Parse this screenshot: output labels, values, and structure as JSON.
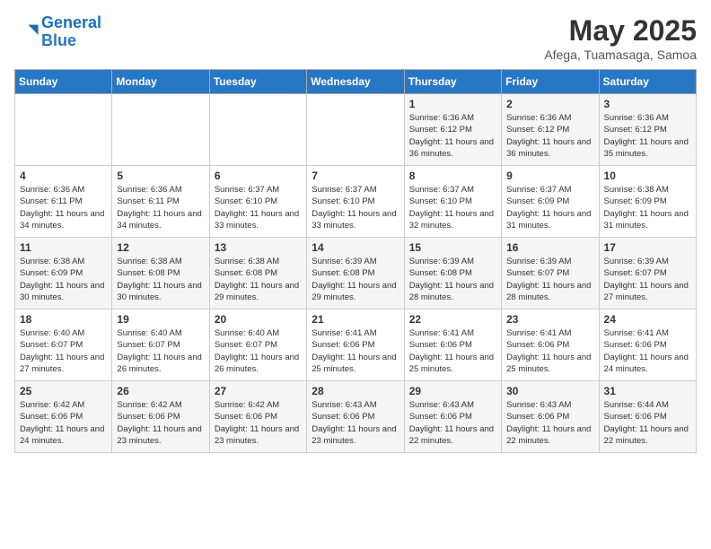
{
  "logo": {
    "line1": "General",
    "line2": "Blue"
  },
  "title": "May 2025",
  "subtitle": "Afega, Tuamasaga, Samoa",
  "weekdays": [
    "Sunday",
    "Monday",
    "Tuesday",
    "Wednesday",
    "Thursday",
    "Friday",
    "Saturday"
  ],
  "weeks": [
    [
      {
        "day": "",
        "info": ""
      },
      {
        "day": "",
        "info": ""
      },
      {
        "day": "",
        "info": ""
      },
      {
        "day": "",
        "info": ""
      },
      {
        "day": "1",
        "info": "Sunrise: 6:36 AM\nSunset: 6:12 PM\nDaylight: 11 hours and 36 minutes."
      },
      {
        "day": "2",
        "info": "Sunrise: 6:36 AM\nSunset: 6:12 PM\nDaylight: 11 hours and 36 minutes."
      },
      {
        "day": "3",
        "info": "Sunrise: 6:36 AM\nSunset: 6:12 PM\nDaylight: 11 hours and 35 minutes."
      }
    ],
    [
      {
        "day": "4",
        "info": "Sunrise: 6:36 AM\nSunset: 6:11 PM\nDaylight: 11 hours and 34 minutes."
      },
      {
        "day": "5",
        "info": "Sunrise: 6:36 AM\nSunset: 6:11 PM\nDaylight: 11 hours and 34 minutes."
      },
      {
        "day": "6",
        "info": "Sunrise: 6:37 AM\nSunset: 6:10 PM\nDaylight: 11 hours and 33 minutes."
      },
      {
        "day": "7",
        "info": "Sunrise: 6:37 AM\nSunset: 6:10 PM\nDaylight: 11 hours and 33 minutes."
      },
      {
        "day": "8",
        "info": "Sunrise: 6:37 AM\nSunset: 6:10 PM\nDaylight: 11 hours and 32 minutes."
      },
      {
        "day": "9",
        "info": "Sunrise: 6:37 AM\nSunset: 6:09 PM\nDaylight: 11 hours and 31 minutes."
      },
      {
        "day": "10",
        "info": "Sunrise: 6:38 AM\nSunset: 6:09 PM\nDaylight: 11 hours and 31 minutes."
      }
    ],
    [
      {
        "day": "11",
        "info": "Sunrise: 6:38 AM\nSunset: 6:09 PM\nDaylight: 11 hours and 30 minutes."
      },
      {
        "day": "12",
        "info": "Sunrise: 6:38 AM\nSunset: 6:08 PM\nDaylight: 11 hours and 30 minutes."
      },
      {
        "day": "13",
        "info": "Sunrise: 6:38 AM\nSunset: 6:08 PM\nDaylight: 11 hours and 29 minutes."
      },
      {
        "day": "14",
        "info": "Sunrise: 6:39 AM\nSunset: 6:08 PM\nDaylight: 11 hours and 29 minutes."
      },
      {
        "day": "15",
        "info": "Sunrise: 6:39 AM\nSunset: 6:08 PM\nDaylight: 11 hours and 28 minutes."
      },
      {
        "day": "16",
        "info": "Sunrise: 6:39 AM\nSunset: 6:07 PM\nDaylight: 11 hours and 28 minutes."
      },
      {
        "day": "17",
        "info": "Sunrise: 6:39 AM\nSunset: 6:07 PM\nDaylight: 11 hours and 27 minutes."
      }
    ],
    [
      {
        "day": "18",
        "info": "Sunrise: 6:40 AM\nSunset: 6:07 PM\nDaylight: 11 hours and 27 minutes."
      },
      {
        "day": "19",
        "info": "Sunrise: 6:40 AM\nSunset: 6:07 PM\nDaylight: 11 hours and 26 minutes."
      },
      {
        "day": "20",
        "info": "Sunrise: 6:40 AM\nSunset: 6:07 PM\nDaylight: 11 hours and 26 minutes."
      },
      {
        "day": "21",
        "info": "Sunrise: 6:41 AM\nSunset: 6:06 PM\nDaylight: 11 hours and 25 minutes."
      },
      {
        "day": "22",
        "info": "Sunrise: 6:41 AM\nSunset: 6:06 PM\nDaylight: 11 hours and 25 minutes."
      },
      {
        "day": "23",
        "info": "Sunrise: 6:41 AM\nSunset: 6:06 PM\nDaylight: 11 hours and 25 minutes."
      },
      {
        "day": "24",
        "info": "Sunrise: 6:41 AM\nSunset: 6:06 PM\nDaylight: 11 hours and 24 minutes."
      }
    ],
    [
      {
        "day": "25",
        "info": "Sunrise: 6:42 AM\nSunset: 6:06 PM\nDaylight: 11 hours and 24 minutes."
      },
      {
        "day": "26",
        "info": "Sunrise: 6:42 AM\nSunset: 6:06 PM\nDaylight: 11 hours and 23 minutes."
      },
      {
        "day": "27",
        "info": "Sunrise: 6:42 AM\nSunset: 6:06 PM\nDaylight: 11 hours and 23 minutes."
      },
      {
        "day": "28",
        "info": "Sunrise: 6:43 AM\nSunset: 6:06 PM\nDaylight: 11 hours and 23 minutes."
      },
      {
        "day": "29",
        "info": "Sunrise: 6:43 AM\nSunset: 6:06 PM\nDaylight: 11 hours and 22 minutes."
      },
      {
        "day": "30",
        "info": "Sunrise: 6:43 AM\nSunset: 6:06 PM\nDaylight: 11 hours and 22 minutes."
      },
      {
        "day": "31",
        "info": "Sunrise: 6:44 AM\nSunset: 6:06 PM\nDaylight: 11 hours and 22 minutes."
      }
    ]
  ]
}
